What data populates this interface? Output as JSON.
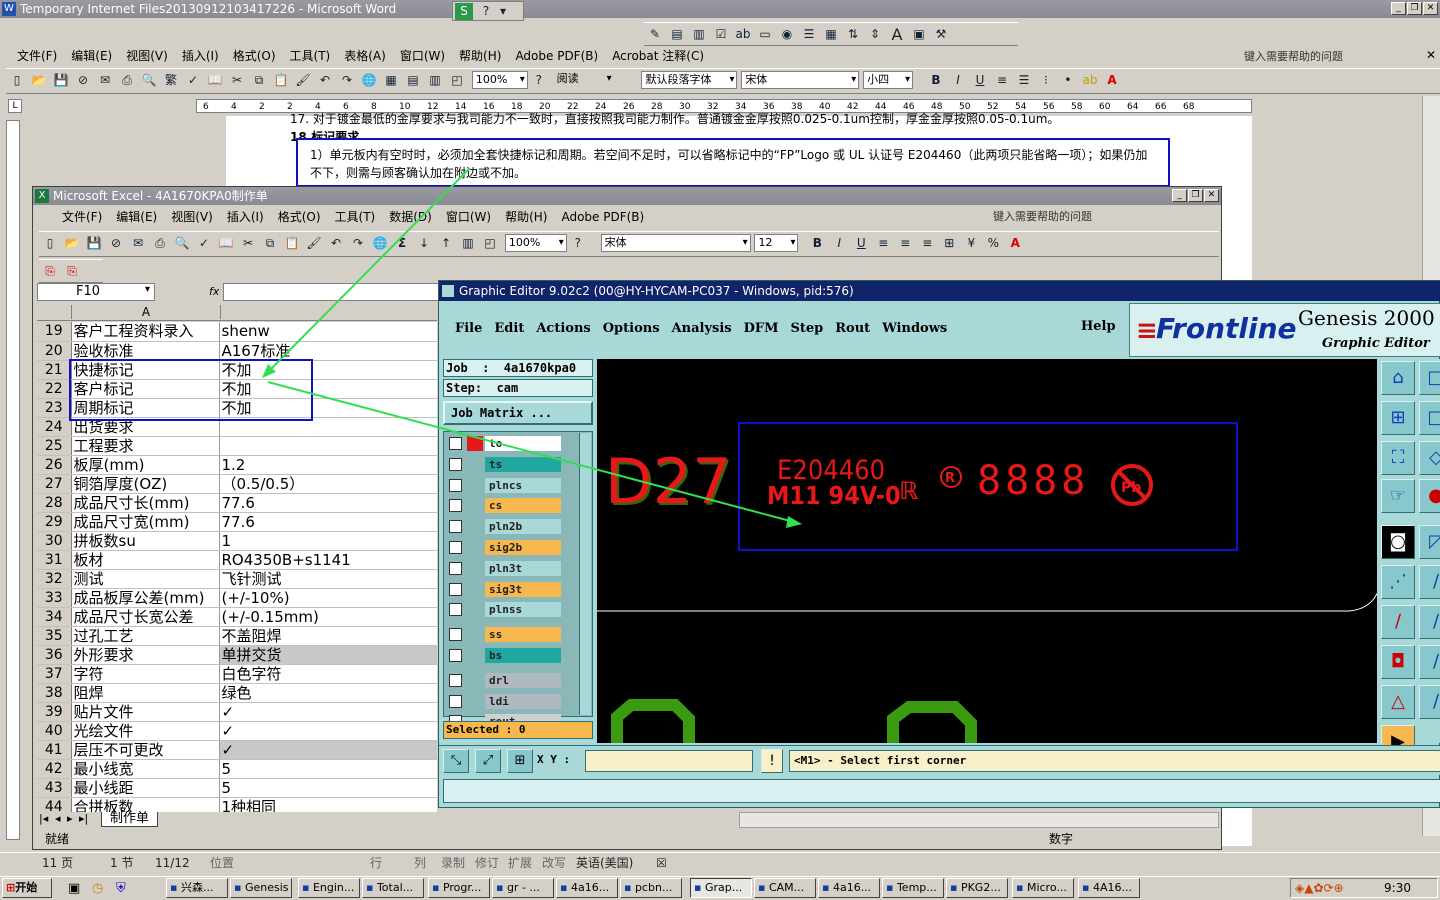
{
  "word": {
    "title": "Temporary Internet Files20130912103417226 - Microsoft Word",
    "menu": [
      "文件(F)",
      "编辑(E)",
      "视图(V)",
      "插入(I)",
      "格式(O)",
      "工具(T)",
      "表格(A)",
      "窗口(W)",
      "帮助(H)",
      "Adobe PDF(B)",
      "Acrobat 注释(C)"
    ],
    "help_placeholder": "键入需要帮助的问题",
    "zoom": "100%",
    "read_label": "阅读",
    "style": "默认段落字体",
    "font": "宋体",
    "size": "小四",
    "ruler": [
      "6",
      "4",
      "2",
      "2",
      "4",
      "6",
      "8",
      "10",
      "12",
      "14",
      "16",
      "18",
      "20",
      "22",
      "24",
      "26",
      "28",
      "30",
      "32",
      "34",
      "36",
      "38",
      "40",
      "42",
      "44",
      "46",
      "48",
      "50",
      "52",
      "54",
      "56",
      "58",
      "60",
      "64",
      "66",
      "68"
    ],
    "doc_top": "17. 对于镀金最低的金厚要求与我司能力不一致时，直接按照我司能力制作。普通镀金金厚按照0.025-0.1um控制，厚金金厚按照0.05-0.1um。",
    "doc_heading": "18.标记要求。",
    "doc_box": "1）单元板内有空时时，必须加全套快捷标记和周期。若空间不足时，可以省略标记中的“FP”Logo 或 UL 认证号 E204460（此两项只能省略一项）；如果仍加不下，则需与顾客确认加在附边或不加。",
    "status": {
      "page": "11 页",
      "section": "1 节",
      "pages": "11/12",
      "position": "位置",
      "row": "行",
      "col": "列",
      "rec": "录制",
      "trk": "修订",
      "ext": "扩展",
      "ovr": "改写",
      "lang": "英语(美国)"
    }
  },
  "excel": {
    "title": "Microsoft Excel - 4A1670KPA0制作单",
    "menu": [
      "文件(F)",
      "编辑(E)",
      "视图(V)",
      "插入(I)",
      "格式(O)",
      "工具(T)",
      "数据(D)",
      "窗口(W)",
      "帮助(H)",
      "Adobe PDF(B)"
    ],
    "help_placeholder": "键入需要帮助的问题",
    "zoom": "100%",
    "font": "宋体",
    "size": "12",
    "cell_ref": "F10",
    "fx": "fx",
    "col_header": "A",
    "rows": [
      {
        "n": "19",
        "a": "客户工程资料录入",
        "b": "shenw"
      },
      {
        "n": "20",
        "a": "验收标准",
        "b": "A167标准"
      },
      {
        "n": "21",
        "a": "快捷标记",
        "b": "不加"
      },
      {
        "n": "22",
        "a": "客户标记",
        "b": "不加"
      },
      {
        "n": "23",
        "a": "周期标记",
        "b": "不加"
      },
      {
        "n": "24",
        "a": "出货要求",
        "b": ""
      },
      {
        "n": "25",
        "a": "工程要求",
        "b": ""
      },
      {
        "n": "26",
        "a": "板厚(mm)",
        "b": "1.2"
      },
      {
        "n": "27",
        "a": "铜箔厚度(OZ)",
        "b": "（0.5/0.5）"
      },
      {
        "n": "28",
        "a": "成品尺寸长(mm)",
        "b": "77.6"
      },
      {
        "n": "29",
        "a": "成品尺寸宽(mm)",
        "b": "77.6"
      },
      {
        "n": "30",
        "a": "拼板数su",
        "b": "1"
      },
      {
        "n": "31",
        "a": "板材",
        "b": "RO4350B+s1141"
      },
      {
        "n": "32",
        "a": "测试",
        "b": "飞针测试"
      },
      {
        "n": "33",
        "a": "成品板厚公差(mm)",
        "b": "(+/-10%)"
      },
      {
        "n": "34",
        "a": "成品尺寸长宽公差",
        "b": "(+/-0.15mm)"
      },
      {
        "n": "35",
        "a": "过孔工艺",
        "b": "不盖阻焊"
      },
      {
        "n": "36",
        "a": "外形要求",
        "b": "单拼交货"
      },
      {
        "n": "37",
        "a": "字符",
        "b": "白色字符"
      },
      {
        "n": "38",
        "a": "阻焊",
        "b": "绿色"
      },
      {
        "n": "39",
        "a": "贴片文件",
        "b": "✓"
      },
      {
        "n": "40",
        "a": "光绘文件",
        "b": "✓"
      },
      {
        "n": "41",
        "a": "层压不可更改",
        "b": "✓"
      },
      {
        "n": "42",
        "a": "最小线宽",
        "b": "5"
      },
      {
        "n": "43",
        "a": "最小线距",
        "b": "5"
      },
      {
        "n": "44",
        "a": "合拼板数",
        "b": "1种相同"
      }
    ],
    "sheet_tab": "制作单",
    "status": "就绪",
    "num": "数字"
  },
  "genesis": {
    "title": "Graphic Editor 9.02c2 (00@HY-HYCAM-PC037 - Windows, pid:576)",
    "menu": [
      "File",
      "Edit",
      "Actions",
      "Options",
      "Analysis",
      "DFM",
      "Step",
      "Rout",
      "Windows"
    ],
    "help": "Help",
    "brand": "Frontline",
    "product": "Genesis 2000",
    "product_sub": "Graphic Editor",
    "job": "Job  :  4a1670kpa0",
    "step": "Step:  cam",
    "matrix": "Job Matrix ...",
    "layers": [
      {
        "name": "to",
        "color": "#ffffff"
      },
      {
        "name": "ts",
        "color": "#20a8a0"
      },
      {
        "name": "plncs",
        "color": "#a8d8d8"
      },
      {
        "name": "cs",
        "color": "#f8b850"
      },
      {
        "name": "pln2b",
        "color": "#a8d8d8"
      },
      {
        "name": "sig2b",
        "color": "#f8b850"
      },
      {
        "name": "pln3t",
        "color": "#a8d8d8"
      },
      {
        "name": "sig3t",
        "color": "#f8b850"
      },
      {
        "name": "plnss",
        "color": "#a8d8d8"
      },
      {
        "name": "ss",
        "color": "#f8b850"
      },
      {
        "name": "bs",
        "color": "#20a8a0"
      },
      {
        "name": "drl",
        "color": "#b0b8c0"
      },
      {
        "name": "ldi",
        "color": "#b0b8c0"
      },
      {
        "name": "rout",
        "color": "#d0d0d0"
      }
    ],
    "selected": "Selected : 0",
    "xy_label": "X Y :",
    "xy_value": "",
    "prompt": "<M1> - Select first corner",
    "marking": {
      "ul": "E204460",
      "grade": "M11 94V-0",
      "date": "8888",
      "refdes": "D27"
    }
  },
  "taskbar": {
    "start": "开始",
    "items": [
      "兴森...",
      "Genesis",
      "Engin...",
      "Total...",
      "Progr...",
      "gr - ...",
      "4a16...",
      "pcbn...",
      "Grap...",
      "CAM...",
      "4a16...",
      "Temp...",
      "PKG2...",
      "Micro...",
      "4A16..."
    ],
    "clock": "9:30"
  },
  "colors": {
    "accent_blue": "#0000cc",
    "arrow": "#30e050",
    "genesis_bg": "#a8d8d8",
    "marking_red": "#e81818"
  }
}
